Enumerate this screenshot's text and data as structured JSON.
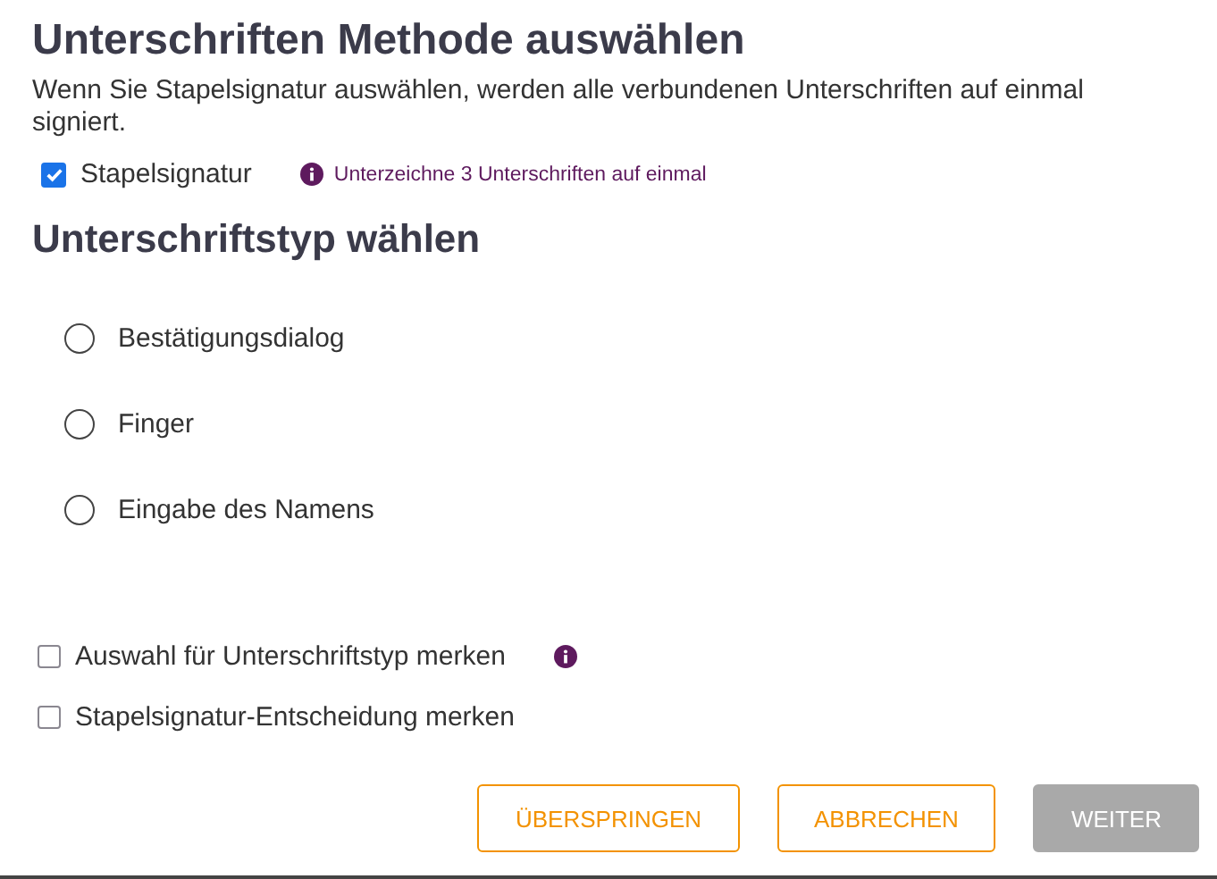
{
  "title": "Unterschriften Methode auswählen",
  "description": "Wenn Sie Stapelsignatur auswählen, werden alle verbundenen Unterschriften auf einmal signiert.",
  "batch": {
    "label": "Stapelsignatur",
    "checked": true,
    "hint": "Unterzeichne 3 Unterschriften auf einmal"
  },
  "type_heading": "Unterschriftstyp wählen",
  "types": [
    {
      "label": "Bestätigungsdialog",
      "selected": false
    },
    {
      "label": "Finger",
      "selected": false
    },
    {
      "label": "Eingabe des Namens",
      "selected": false
    }
  ],
  "remember": [
    {
      "label": "Auswahl für Unterschriftstyp merken",
      "checked": false,
      "info": true
    },
    {
      "label": "Stapelsignatur-Entscheidung merken",
      "checked": false,
      "info": false
    }
  ],
  "buttons": [
    {
      "label": "ÜBERSPRINGEN",
      "disabled": false
    },
    {
      "label": "ABBRECHEN",
      "disabled": false
    },
    {
      "label": "WEITER",
      "disabled": true
    }
  ]
}
